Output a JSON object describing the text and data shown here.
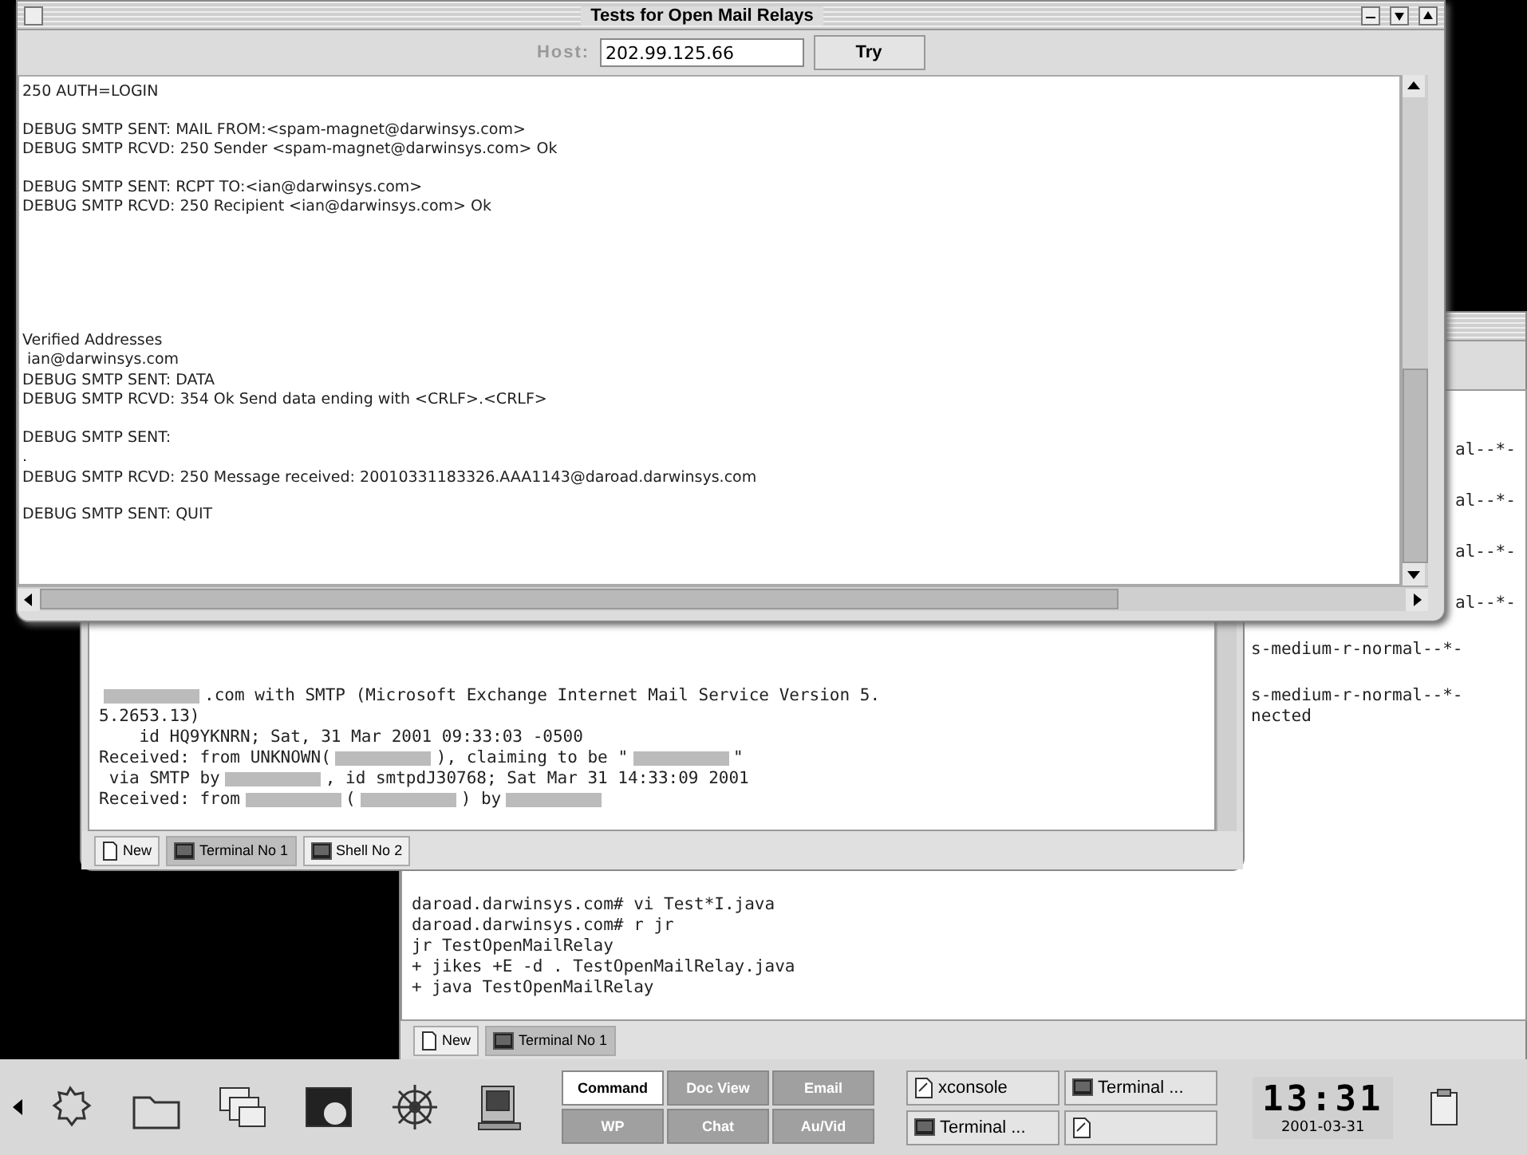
{
  "main_window": {
    "title": "Tests for Open Mail Relays",
    "host_label": "Host:",
    "host_value": "202.99.125.66",
    "try_button": "Try",
    "log_groups": [
      [
        "250 AUTH=LOGIN"
      ],
      [
        "DEBUG SMTP SENT: MAIL FROM:<spam-magnet@darwinsys.com>",
        "DEBUG SMTP RCVD: 250 Sender <spam-magnet@darwinsys.com> Ok"
      ],
      [
        "DEBUG SMTP SENT: RCPT TO:<ian@darwinsys.com>",
        "DEBUG SMTP RCVD: 250 Recipient <ian@darwinsys.com> Ok"
      ],
      [
        "Verified Addresses",
        " ian@darwinsys.com",
        "DEBUG SMTP SENT: DATA",
        "DEBUG SMTP RCVD: 354 Ok Send data ending with <CRLF>.<CRLF>"
      ],
      [
        "DEBUG SMTP SENT:",
        ".",
        "DEBUG SMTP RCVD: 250 Message received: 20010331183326.AAA1143@daroad.darwinsys.com"
      ],
      [
        "DEBUG SMTP SENT: QUIT"
      ]
    ]
  },
  "shell_window": {
    "lines": [
      [
        {
          "kind": "redacted"
        },
        {
          "kind": "text",
          "text": ".com with SMTP (Microsoft Exchange Internet Mail Service Version 5."
        }
      ],
      [
        {
          "kind": "text",
          "text": "5.2653.13)"
        }
      ],
      [
        {
          "kind": "text",
          "text": "    id HQ9YKNRN; Sat, 31 Mar 2001 09:33:03 -0500"
        }
      ],
      [
        {
          "kind": "text",
          "text": "Received: from UNKNOWN("
        },
        {
          "kind": "redacted"
        },
        {
          "kind": "text",
          "text": "), claiming to be \""
        },
        {
          "kind": "redacted"
        },
        {
          "kind": "text",
          "text": "\""
        }
      ],
      [
        {
          "kind": "text",
          "text": " via SMTP by"
        },
        {
          "kind": "redacted"
        },
        {
          "kind": "text",
          "text": ", id smtpdJ30768; Sat Mar 31 14:33:09 2001"
        }
      ],
      [
        {
          "kind": "text",
          "text": "Received: from"
        },
        {
          "kind": "redacted"
        },
        {
          "kind": "text",
          "text": "("
        },
        {
          "kind": "redacted"
        },
        {
          "kind": "text",
          "text": ") by"
        },
        {
          "kind": "redacted"
        }
      ]
    ],
    "tabs": [
      {
        "label": "New",
        "kind": "new",
        "selected": false
      },
      {
        "label": "Terminal No 1",
        "kind": "terminal",
        "selected": true
      },
      {
        "label": "Shell No 2",
        "kind": "terminal",
        "selected": false
      }
    ]
  },
  "terminal_window": {
    "upper_lines": [
      "al--*-",
      "al--*-",
      "al--*-",
      "al--*-",
      "s-medium-r-normal--*-",
      "s-medium-r-normal--*-",
      "nected"
    ],
    "lower_lines": [
      "daroad.darwinsys.com# vi Test*I.java",
      "daroad.darwinsys.com# r jr",
      "jr TestOpenMailRelay",
      "+ jikes +E -d . TestOpenMailRelay.java",
      "+ java TestOpenMailRelay"
    ],
    "tabs": [
      {
        "label": "New",
        "kind": "new",
        "selected": false
      },
      {
        "label": "Terminal No 1",
        "kind": "terminal",
        "selected": true
      }
    ]
  },
  "taskbar": {
    "desktops": [
      {
        "label": "Command",
        "selected": true
      },
      {
        "label": "Doc View",
        "selected": false
      },
      {
        "label": "Email",
        "selected": false
      },
      {
        "label": "WP",
        "selected": false
      },
      {
        "label": "Chat",
        "selected": false
      },
      {
        "label": "Au/Vid",
        "selected": false
      }
    ],
    "tasks": [
      {
        "label": "xconsole",
        "kind": "console"
      },
      {
        "label": "Terminal ...",
        "kind": "terminal"
      },
      {
        "label": "Terminal ...",
        "kind": "terminal"
      },
      {
        "kind": "console"
      }
    ],
    "clock": "13:31",
    "date": "2001-03-31"
  }
}
